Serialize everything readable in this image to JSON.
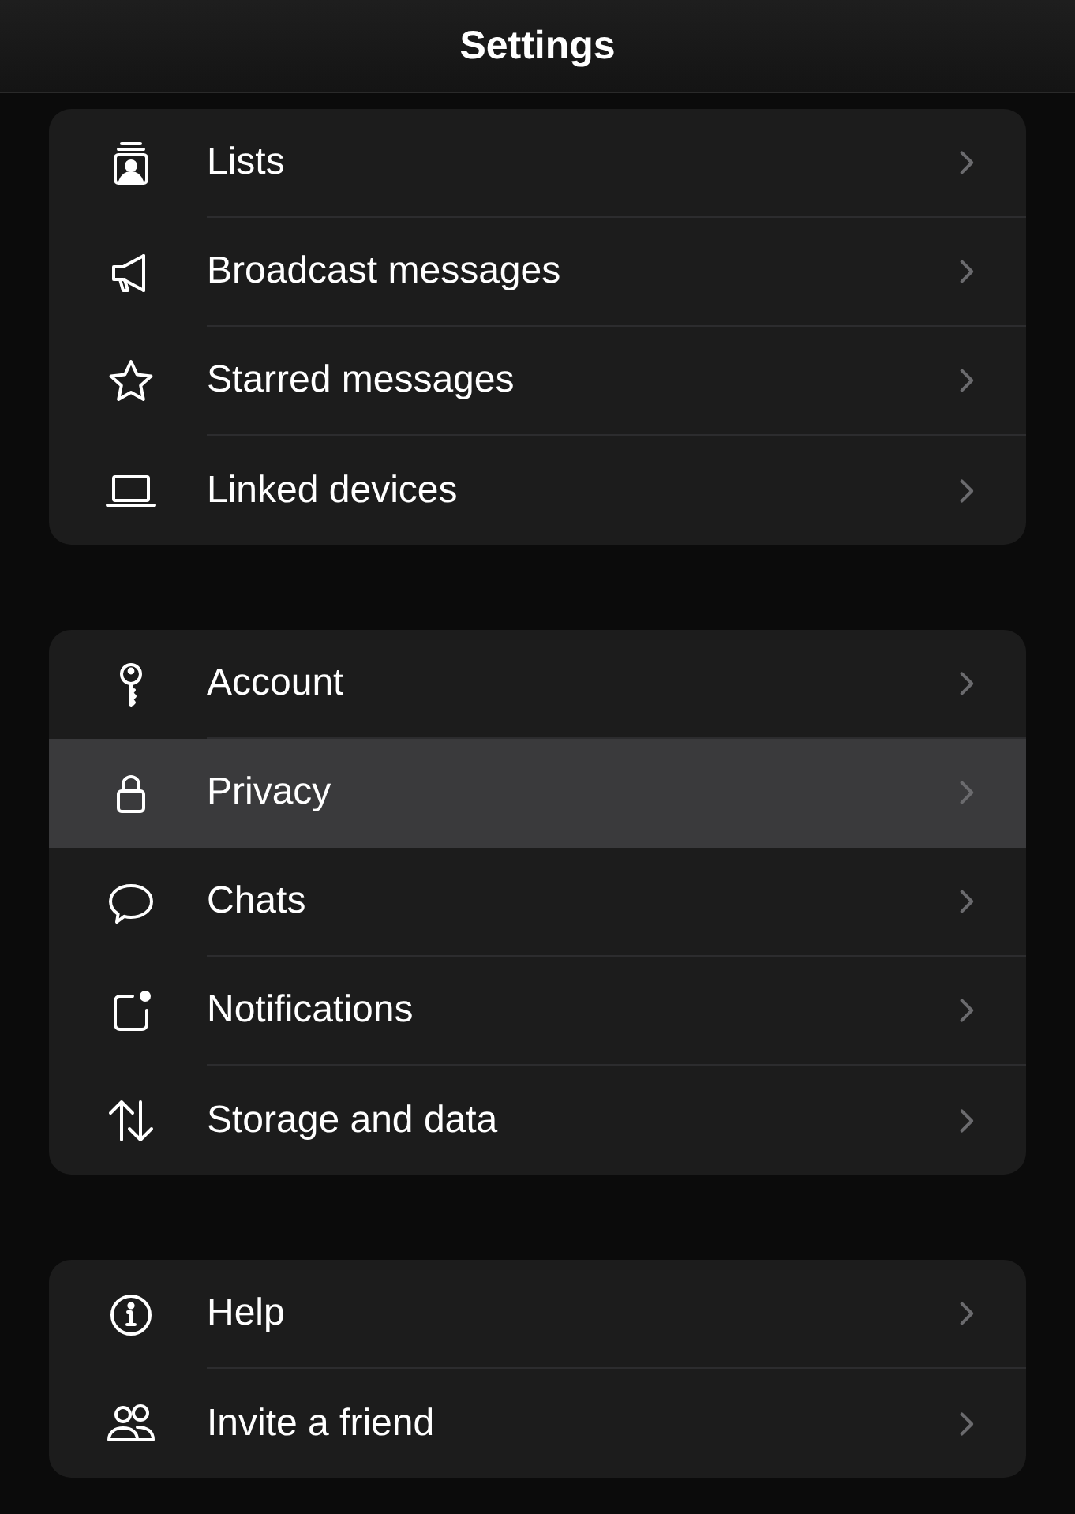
{
  "header": {
    "title": "Settings"
  },
  "groups": [
    {
      "items": [
        {
          "label": "Lists",
          "selected": false
        },
        {
          "label": "Broadcast messages",
          "selected": false
        },
        {
          "label": "Starred messages",
          "selected": false
        },
        {
          "label": "Linked devices",
          "selected": false
        }
      ]
    },
    {
      "items": [
        {
          "label": "Account",
          "selected": false
        },
        {
          "label": "Privacy",
          "selected": true
        },
        {
          "label": "Chats",
          "selected": false
        },
        {
          "label": "Notifications",
          "selected": false
        },
        {
          "label": "Storage and data",
          "selected": false
        }
      ]
    },
    {
      "items": [
        {
          "label": "Help",
          "selected": false
        },
        {
          "label": "Invite a friend",
          "selected": false
        }
      ]
    }
  ]
}
